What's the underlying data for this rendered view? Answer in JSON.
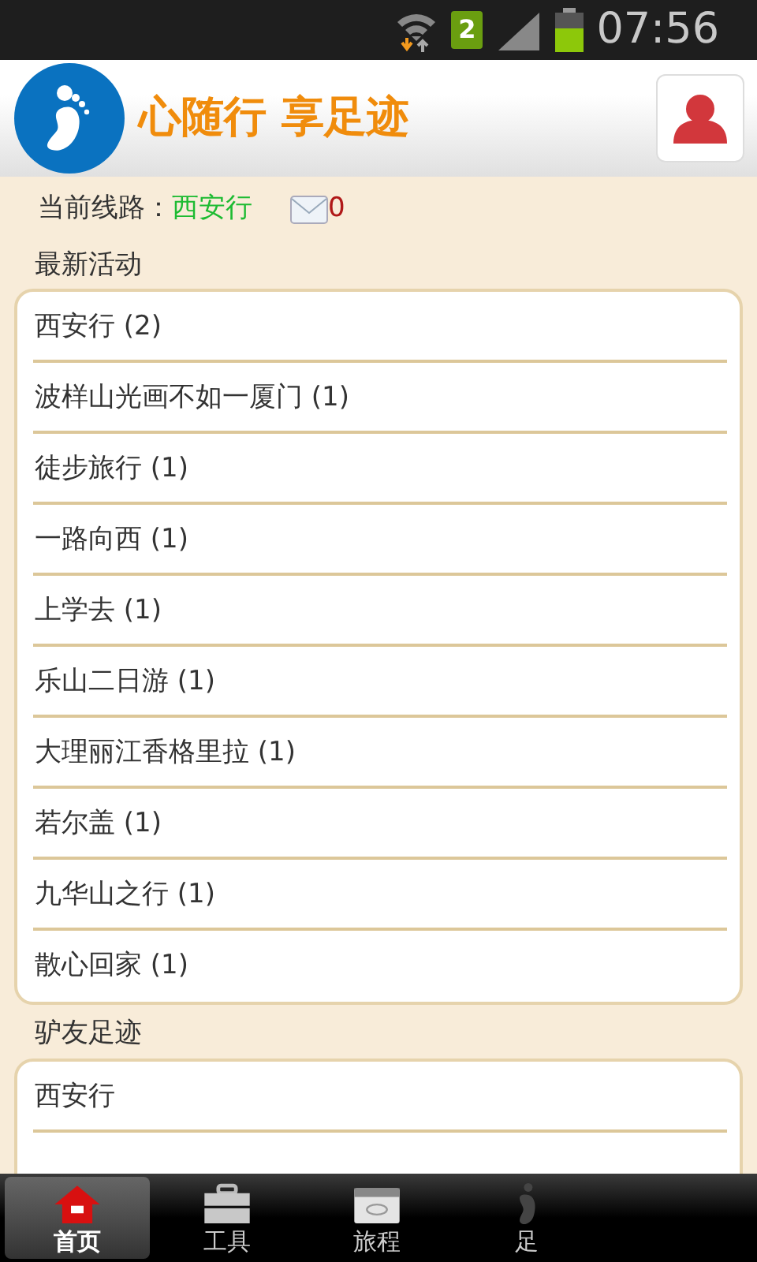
{
  "status_bar": {
    "sim": "2",
    "time": "07:56"
  },
  "header": {
    "title": "心随行 享足迹"
  },
  "route": {
    "label": "当前线路：",
    "value": "西安行",
    "messages": "0"
  },
  "sections": [
    {
      "title": "最新活动",
      "items": [
        "西安行 (2)",
        "波样山光画不如一厦门 (1)",
        "徒步旅行 (1)",
        "一路向西 (1)",
        "上学去 (1)",
        "乐山二日游 (1)",
        "大理丽江香格里拉 (1)",
        "若尔盖 (1)",
        "九华山之行 (1)",
        "散心回家 (1)"
      ]
    },
    {
      "title": "驴友足迹",
      "items": [
        "西安行"
      ]
    }
  ],
  "tabs": [
    {
      "label": "首页",
      "kind": "home",
      "selected": true
    },
    {
      "label": "工具",
      "kind": "toolbox",
      "selected": false
    },
    {
      "label": "旅程",
      "kind": "calendar",
      "selected": false
    },
    {
      "label": "足",
      "kind": "footprint",
      "selected": false
    }
  ]
}
